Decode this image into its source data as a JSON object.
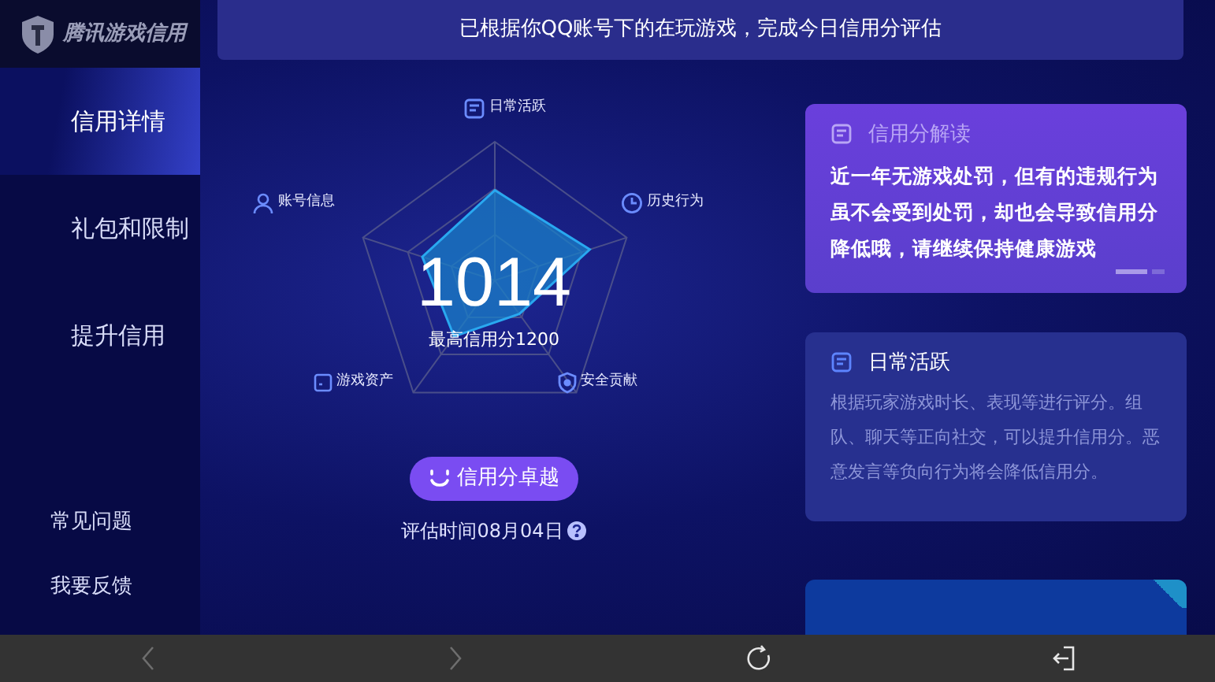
{
  "sidebar": {
    "logo": "腾讯游戏信用",
    "items": [
      {
        "label": "信用详情",
        "selected": true
      },
      {
        "label": "礼包和限制",
        "selected": false
      },
      {
        "label": "提升信用",
        "selected": false
      }
    ],
    "footer_links": [
      "常见问题",
      "我要反馈"
    ]
  },
  "banner": "已根据你QQ账号下的在玩游戏，完成今日信用分评估",
  "radar": {
    "labels": [
      {
        "kind": "doc",
        "text": "日常活跃"
      },
      {
        "kind": "clock",
        "text": "历史行为"
      },
      {
        "kind": "shield",
        "text": "安全贡献"
      },
      {
        "kind": "box",
        "text": "游戏资产"
      },
      {
        "kind": "user",
        "text": "账号信息"
      }
    ],
    "score": "1014",
    "max_label": "最高信用分1200"
  },
  "grade_button": "信用分卓越",
  "eval_time": "评估时间08月04日",
  "cards": [
    {
      "kind": "highlight",
      "title": "信用分解读",
      "text": "近一年无游戏处罚，但有的违规行为虽不会受到处罚，却也会导致信用分降低哦，请继续保持健康游戏",
      "pager": [
        {
          "selected": true
        },
        {
          "selected": false
        }
      ]
    },
    {
      "kind": "plain",
      "title": "日常活跃",
      "text": "根据玩家游戏时长、表现等进行评分。组队、聊天等正向社交，可以提升信用分。恶意发言等负向行为将会降低信用分。"
    },
    {
      "kind": "partial"
    }
  ],
  "nav_bar": [
    {
      "kind": "back",
      "disabled": true
    },
    {
      "kind": "forward",
      "disabled": true
    },
    {
      "kind": "refresh",
      "disabled": false
    },
    {
      "kind": "exit",
      "disabled": false
    }
  ]
}
